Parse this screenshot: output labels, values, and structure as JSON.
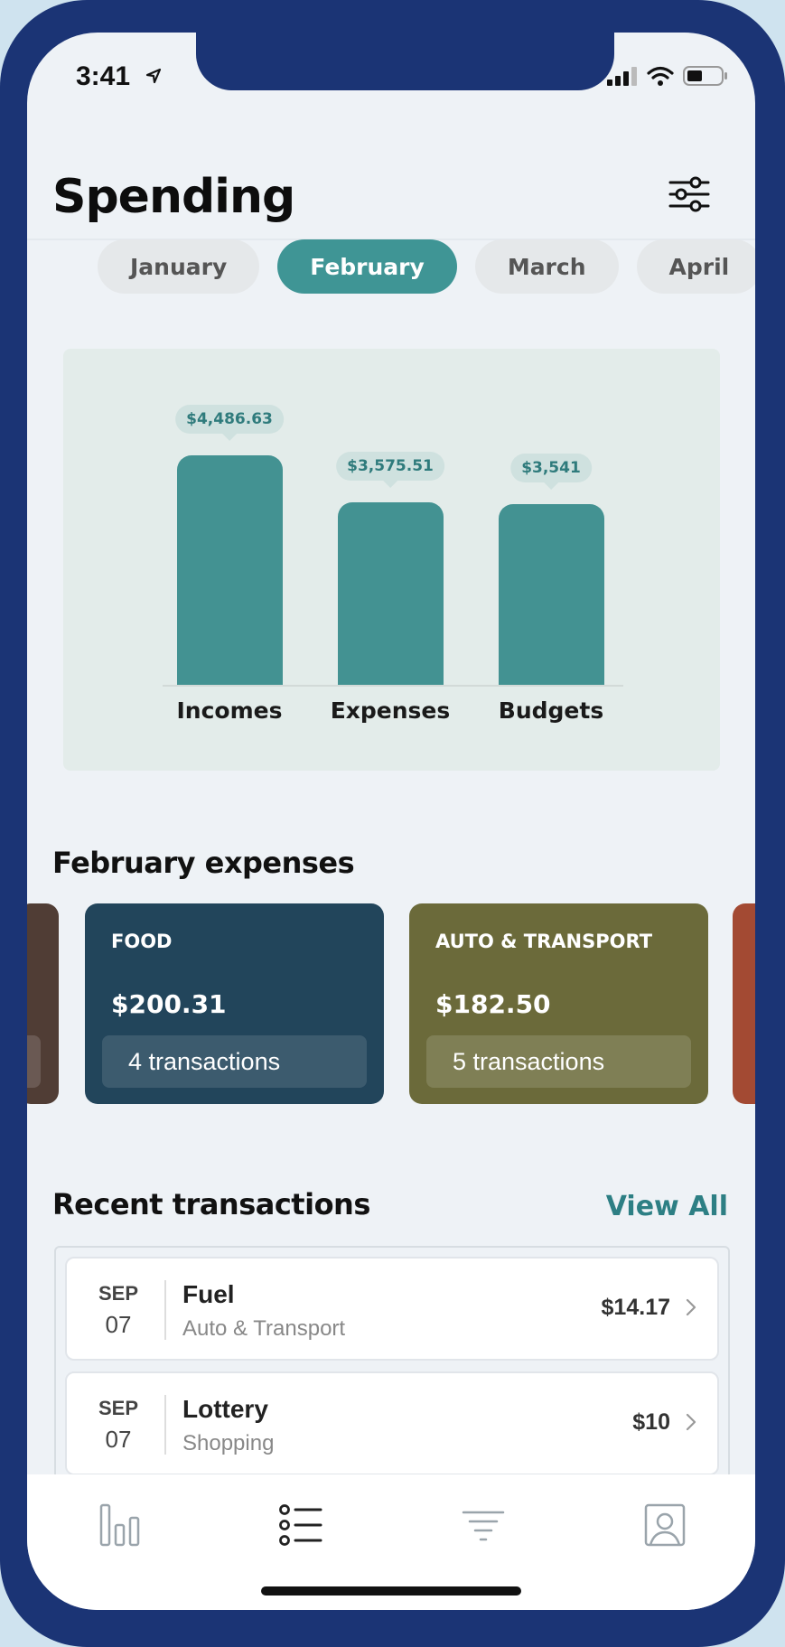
{
  "status_bar": {
    "time": "3:41"
  },
  "header": {
    "title": "Spending"
  },
  "months": [
    {
      "label": "January",
      "active": false
    },
    {
      "label": "February",
      "active": true
    },
    {
      "label": "March",
      "active": false
    },
    {
      "label": "April",
      "active": false
    }
  ],
  "chart_data": {
    "type": "bar",
    "categories": [
      "Incomes",
      "Expenses",
      "Budgets"
    ],
    "values": [
      4486.63,
      3575.51,
      3541
    ],
    "value_labels": [
      "$4,486.63",
      "$3,575.51",
      "$3,541"
    ],
    "ylim": [
      0,
      4486.63
    ],
    "grid": false,
    "bar_color": "#439292"
  },
  "expenses_section": {
    "title": "February expenses",
    "cards": [
      {
        "name": "FOOD",
        "amount": "$200.31",
        "transactions": "4 transactions",
        "color": "#22455b"
      },
      {
        "name": "AUTO & TRANSPORT",
        "amount": "$182.50",
        "transactions": "5 transactions",
        "color": "#6b6a3a"
      }
    ],
    "edge_colors": {
      "left": "#503d35",
      "right": "#a34a33"
    }
  },
  "recent": {
    "title": "Recent transactions",
    "view_all": "View All",
    "transactions": [
      {
        "month": "SEP",
        "day": "07",
        "name": "Fuel",
        "category": "Auto & Transport",
        "amount": "$14.17"
      },
      {
        "month": "SEP",
        "day": "07",
        "name": "Lottery",
        "category": "Shopping",
        "amount": "$10"
      }
    ]
  },
  "tabbar": {
    "items": [
      {
        "icon": "bar-chart-icon",
        "active": false
      },
      {
        "icon": "list-icon",
        "active": true
      },
      {
        "icon": "filter-icon",
        "active": false
      },
      {
        "icon": "profile-icon",
        "active": false
      }
    ]
  },
  "colors": {
    "accent": "#3f9595",
    "frame": "#1b3475",
    "link": "#2d7f84"
  }
}
